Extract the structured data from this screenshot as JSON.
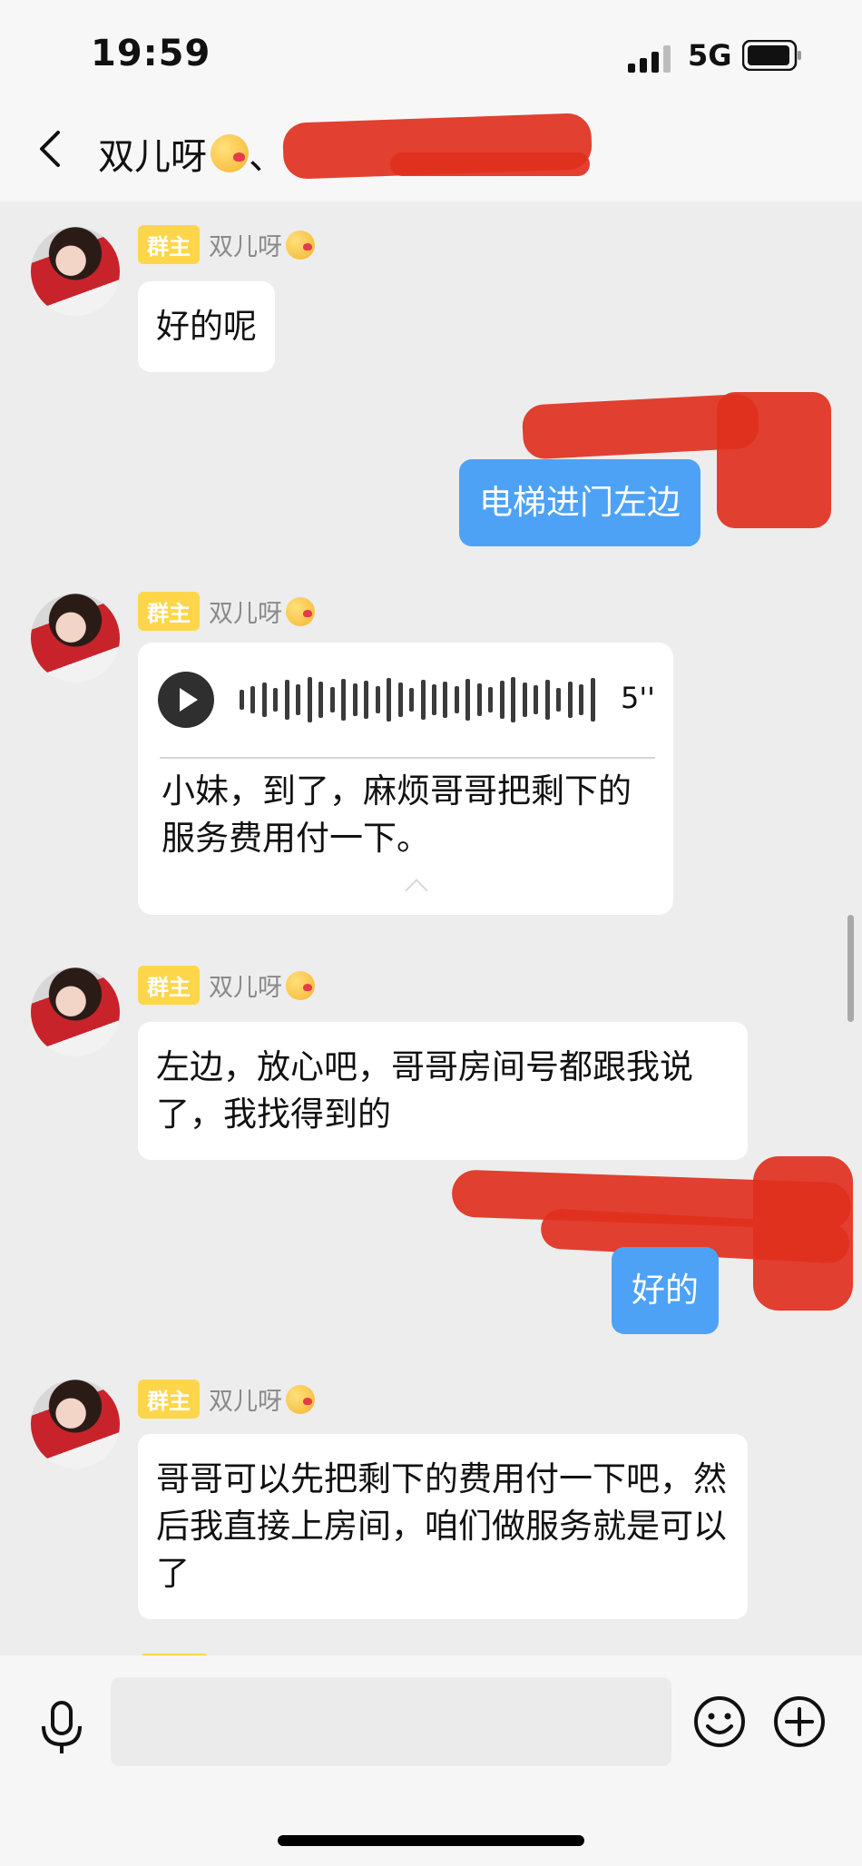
{
  "status_bar": {
    "time": "19:59",
    "network": "5G",
    "signal_bars": 4,
    "battery_level": 0.9
  },
  "header": {
    "title": "双儿呀",
    "separator": "、"
  },
  "messages": [
    {
      "side": "left",
      "badge": "群主",
      "sender": "双儿呀",
      "text": "好的呢"
    },
    {
      "side": "right",
      "text": "电梯进门左边"
    },
    {
      "side": "left",
      "badge": "群主",
      "sender": "双儿呀",
      "type": "voice",
      "duration": "5''",
      "transcript": "小妹，到了，麻烦哥哥把剩下的服务费用付一下。"
    },
    {
      "side": "left",
      "badge": "群主",
      "sender": "双儿呀",
      "text": "左边，放心吧，哥哥房间号都跟我说了，我找得到的"
    },
    {
      "side": "right",
      "text": "好的"
    },
    {
      "side": "left",
      "badge": "群主",
      "sender": "双儿呀",
      "text": "哥哥可以先把剩下的费用付一下吧，然后我直接上房间，咱们做服务就是可以了"
    }
  ],
  "input": {
    "placeholder": ""
  },
  "icons": {
    "back": "back-arrow-icon",
    "mic": "microphone-icon",
    "emoji": "emoji-smile-icon",
    "plus": "plus-circle-icon"
  },
  "colors": {
    "sent_bubble": "#4da2f6",
    "badge": "#ffd64a",
    "redaction": "#e0301e"
  }
}
